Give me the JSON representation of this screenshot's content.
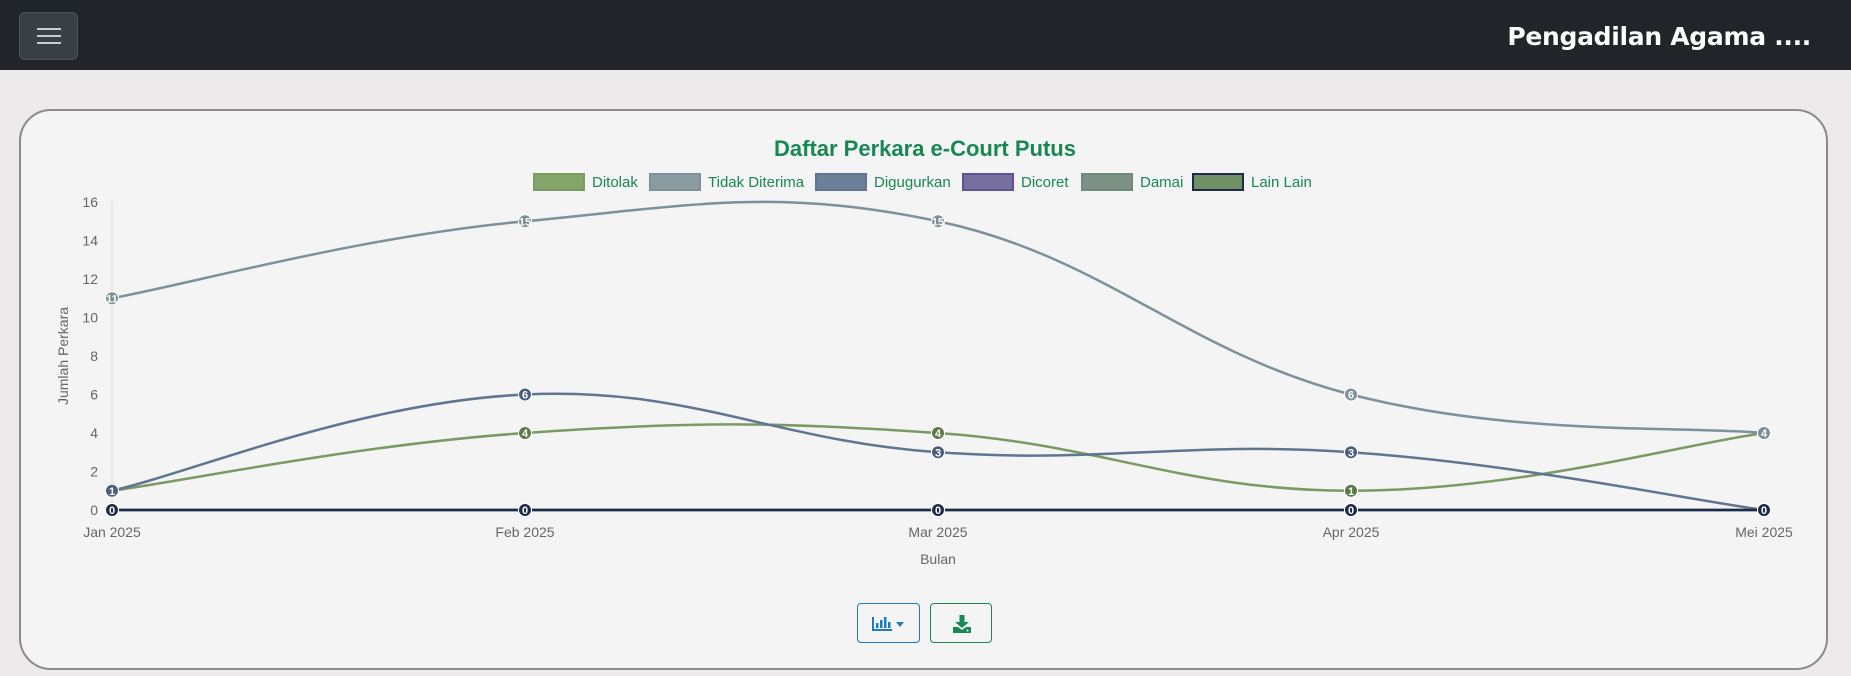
{
  "header": {
    "brand": "Pengadilan Agama ....",
    "menu_icon": "hamburger-icon"
  },
  "colors": {
    "title": "#198754",
    "legend_text": "#198754",
    "axis_text": "#666666",
    "chart_btn": "#1f7bc1",
    "download_btn": "#198754"
  },
  "toolbar": {
    "chart_type_icon": "bar-chart-icon",
    "caret_icon": "caret-down-icon",
    "download_icon": "download-icon"
  },
  "chart_data": {
    "type": "line",
    "title": "Daftar Perkara e-Court Putus",
    "xlabel": "Bulan",
    "ylabel": "Jumlah Perkara",
    "categories": [
      "Jan 2025",
      "Feb 2025",
      "Mar 2025",
      "Apr 2025",
      "Mei 2025"
    ],
    "ylim": [
      0,
      16
    ],
    "yticks": [
      "0",
      "2",
      "4",
      "6",
      "8",
      "10",
      "12",
      "14",
      "16"
    ],
    "legend_position": "top",
    "grid": false,
    "series": [
      {
        "name": "Ditolak",
        "values": [
          1,
          4,
          4,
          1,
          4
        ],
        "color": "#7a9a64",
        "fill": "#85a56a",
        "label_color": "#5b7a45"
      },
      {
        "name": "Tidak Diterima",
        "values": [
          11,
          15,
          15,
          6,
          4
        ],
        "color": "#7e9198",
        "fill": "#8a9ba1",
        "label_color": "#7e9198"
      },
      {
        "name": "Digugurkan",
        "values": [
          1,
          6,
          3,
          3,
          0
        ],
        "color": "#5f7591",
        "fill": "#6d8099",
        "label_color": "#4a5f7b"
      },
      {
        "name": "Dicoret",
        "values": [
          0,
          0,
          0,
          0,
          0
        ],
        "color": "#5e5590",
        "fill": "#77709e",
        "label_color": "#3a3470"
      },
      {
        "name": "Damai",
        "values": [
          0,
          0,
          0,
          0,
          0
        ],
        "color": "#6f8a7c",
        "fill": "#7d9285",
        "label_color": "#4a6356"
      },
      {
        "name": "Lain Lain",
        "values": [
          0,
          0,
          0,
          0,
          0
        ],
        "color": "#1e2a4a",
        "fill": "#6f8f67",
        "label_color": "#1e2a4a"
      }
    ]
  }
}
